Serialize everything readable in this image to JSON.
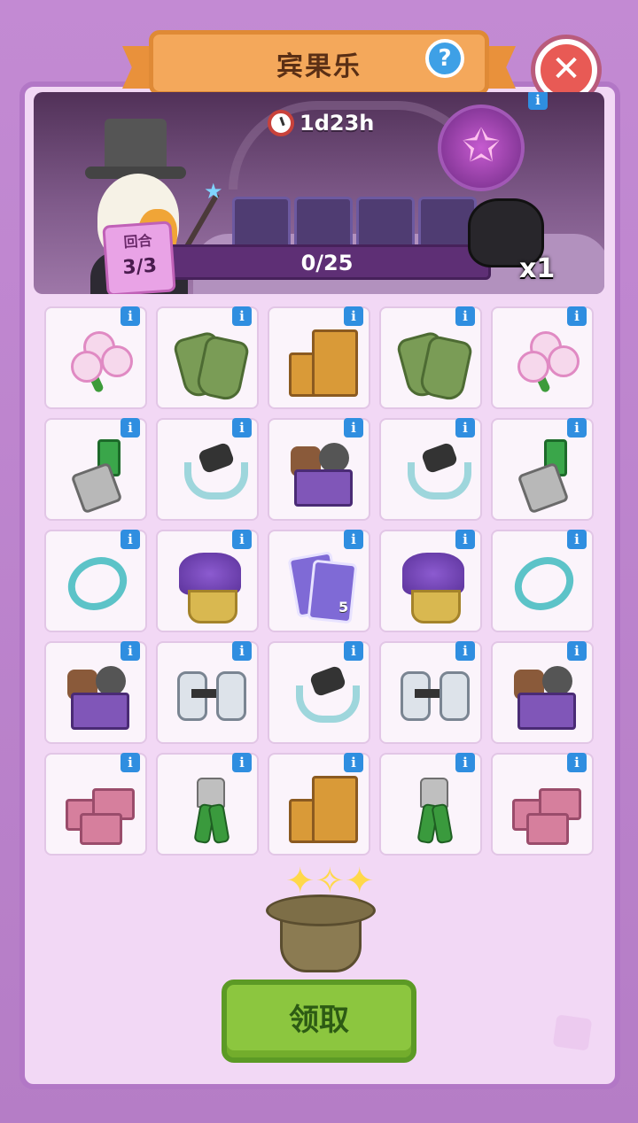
{
  "header": {
    "title": "宾果乐",
    "help_icon": "question-icon",
    "close_icon": "close-icon",
    "help_glyph": "?",
    "close_glyph": "✕"
  },
  "banner": {
    "timer": "1d23h",
    "round_label": "回合",
    "round_value": "3/3",
    "progress_text": "0/25",
    "progress_fraction": 0.0,
    "reward_multiplier": "x1",
    "info_glyph": "i"
  },
  "grid": {
    "info_glyph": "i",
    "rows": [
      [
        "flower-bouquet",
        "work-gloves",
        "wooden-drawers",
        "work-gloves",
        "flower-bouquet"
      ],
      [
        "adjustable-wrench",
        "hose-tube",
        "mystery-box",
        "hose-tube",
        "adjustable-wrench"
      ],
      [
        "hoop-ring",
        "lavender-basket",
        "sticker-cards",
        "lavender-basket",
        "hoop-ring"
      ],
      [
        "mystery-box",
        "dumbbell",
        "hose-tube",
        "dumbbell",
        "mystery-box"
      ],
      [
        "toy-bricks",
        "pliers",
        "wooden-drawers",
        "pliers",
        "toy-bricks"
      ]
    ],
    "card_count_label": "5"
  },
  "footer": {
    "claim_label": "领取",
    "magic_hat_icon": "magic-hat-icon"
  },
  "colors": {
    "background": "#b782c7",
    "panel": "#f2d8f5",
    "ribbon": "#f4a85b",
    "info": "#2f8ee0",
    "claim": "#8cc63f",
    "close": "#e85a55"
  }
}
